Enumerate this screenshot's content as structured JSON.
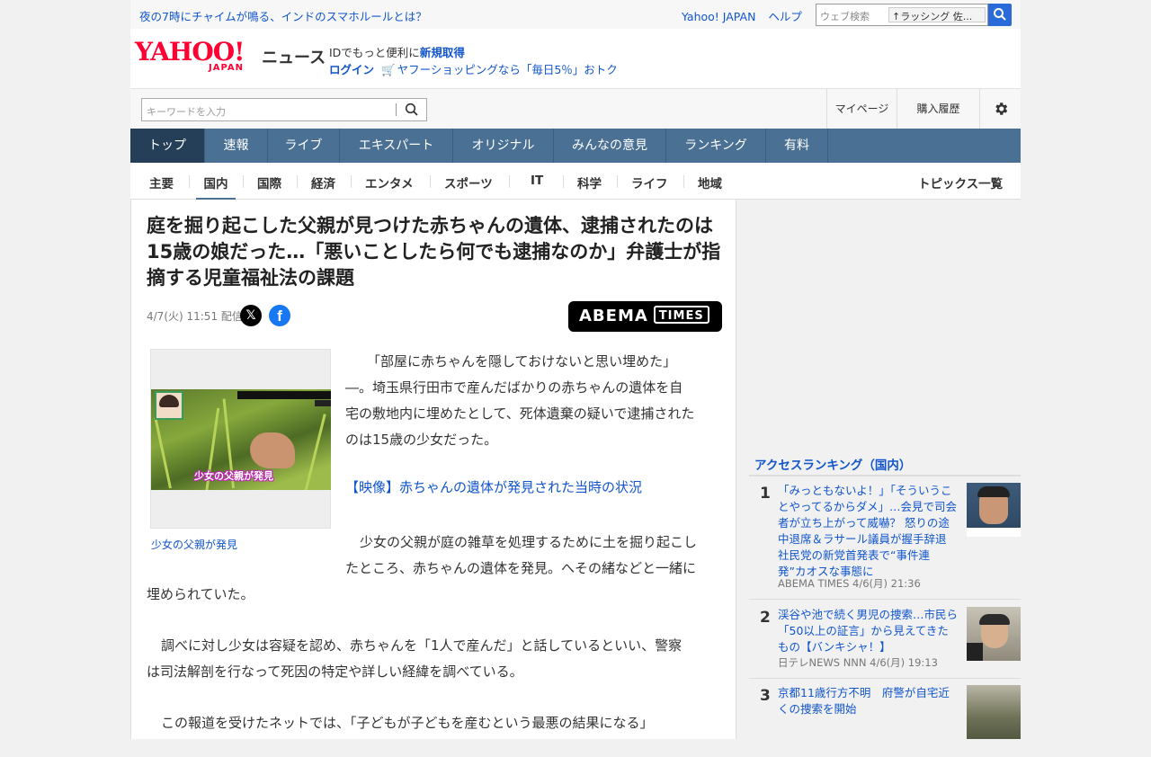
{
  "topbar": {
    "headline": "夜の7時にチャイムが鳴る、インドのスマホルールとは？",
    "links": [
      "Yahoo! JAPAN",
      "ヘルプ"
    ],
    "websearch_placeholder": "ウェブ検索",
    "websearch_keyword": "ラッシング 佐..."
  },
  "header": {
    "logo": "YAHOO!",
    "logo_sub": "JAPAN",
    "service": "ニュース",
    "acct_prefix": "IDでもっと便利に",
    "acct_register": "新規取得",
    "login": "ログイン",
    "shopping_promo": "ヤフーショッピングなら「毎日5％」おトク"
  },
  "search": {
    "placeholder": "キーワードを入力",
    "mypage": "マイページ",
    "history": "購入履歴"
  },
  "main_nav": [
    "トップ",
    "速報",
    "ライブ",
    "エキスパート",
    "オリジナル",
    "みんなの意見",
    "ランキング",
    "有料"
  ],
  "sub_nav": [
    "主要",
    "国内",
    "国際",
    "経済",
    "エンタメ",
    "スポーツ",
    "IT",
    "科学",
    "ライフ",
    "地域"
  ],
  "sub_nav_active": "国内",
  "topics_link": "トピックス一覧",
  "article": {
    "title": "庭を掘り起こした父親が見つけた赤ちゃんの遺体、逮捕されたのは15歳の娘だった…「悪いことしたら何でも逮捕なのか」弁護士が指摘する児童福祉法の課題",
    "date": "4/7(火) 11:51 配信",
    "publisher_logo": "ABEMA",
    "publisher_logo_sub": "TIMES",
    "image_caption_overlay": "少女の父親が発見",
    "figure_caption": "少女の父親が発見",
    "para1_l1": "「部屋に赤ちゃんを隠しておけないと思い埋めた」",
    "para1_l2": "―。埼玉県行田市で産んだばかりの赤ちゃんの遺体を自",
    "para1_l3": "宅の敷地内に埋めたとして、死体遺棄の疑いで逮捕された",
    "para1_l4": "のは15歳の少女だった。",
    "video_link": "【映像】赤ちゃんの遺体が発見された当時の状況",
    "para2_l1": "少女の父親が庭の雑草を処理するために土を掘り起こし",
    "para2_l2": "たところ、赤ちゃんの遺体を発見。へその緒などと一緒に",
    "para2_l3": "埋められていた。",
    "para3_l1": "調べに対し少女は容疑を認め、赤ちゃんを「1人で産んだ」と話しているといい、警察",
    "para3_l2": "は司法解剖を行なって死因の特定や詳しい経緯を調べている。",
    "para4_l1": "この報道を受けたネットでは、「子どもが子どもを産むという最悪の結果になる」"
  },
  "ranking": {
    "title": "アクセスランキング（国内）",
    "items": [
      {
        "rank": "1",
        "text": "「みっともないよ！」「そういうことやってるからダメ」…会見で司会者が立ち上がって威嚇？ 怒りの途中退席＆ラサール議員が握手辞退 社民党の新党首発表で“事件連発”カオスな事態に",
        "source": "ABEMA TIMES 4/6(月) 21:36"
      },
      {
        "rank": "2",
        "text": "渓谷や池で続く男児の捜索…市民ら「50以上の証言」から見えてきたもの【バンキシャ！】",
        "source": "日テレNEWS NNN 4/6(月) 19:13"
      },
      {
        "rank": "3",
        "text": "京都11歳行方不明　府警が自宅近くの捜索を開始",
        "source": ""
      }
    ]
  },
  "colors": {
    "link": "#1155cc",
    "nav": "#4a7094",
    "nav_active": "#253f58",
    "yahoo_red": "#ff0033"
  }
}
